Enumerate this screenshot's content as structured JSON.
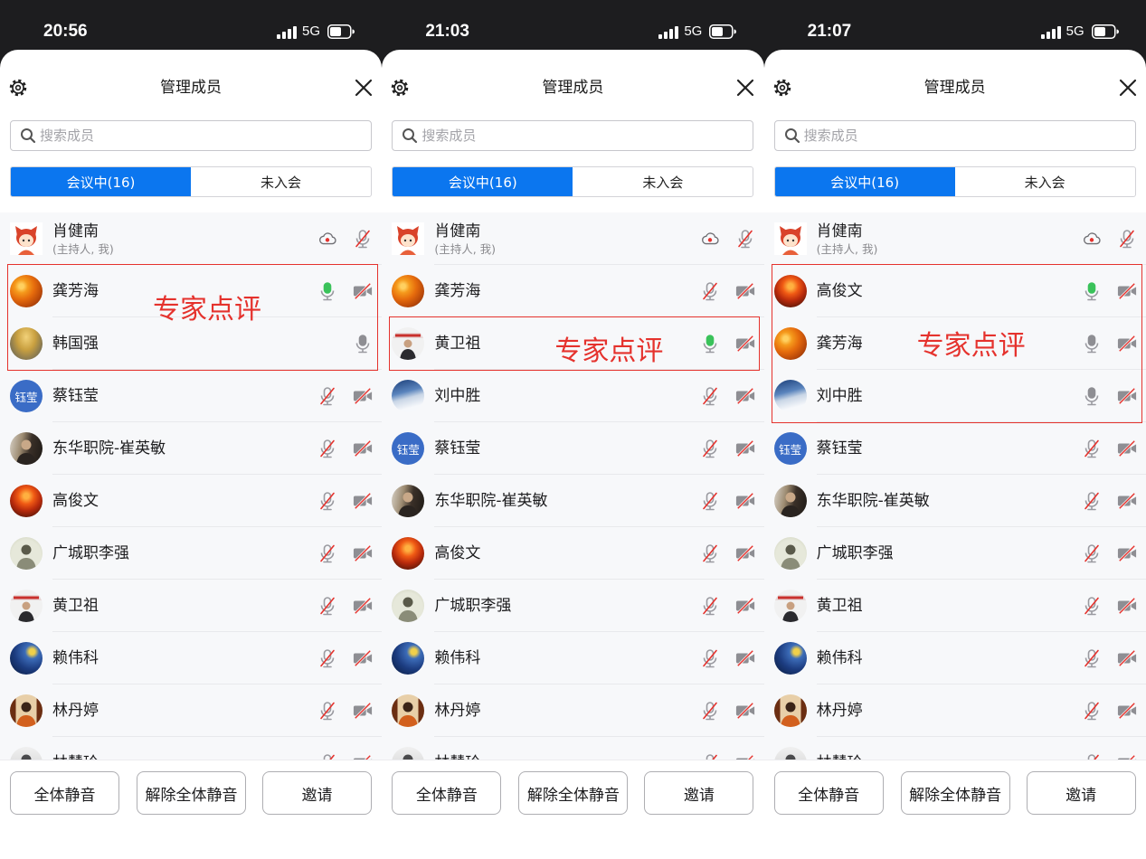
{
  "theme": {
    "accent": "#0b76ef",
    "annotation": "#e5322d",
    "mic_active": "#3ac25a",
    "status_bar": "#1d1d1f"
  },
  "panels": [
    {
      "status_bar": {
        "time": "20:56",
        "network": "5G",
        "signal_icon": "signal-icon",
        "battery_icon": "battery-icon"
      },
      "header": {
        "settings_icon": "gear-icon",
        "title": "管理成员",
        "close_icon": "close-icon"
      },
      "search": {
        "icon": "search-icon",
        "placeholder": "搜索成员"
      },
      "tabs": [
        {
          "label": "会议中(16)",
          "active": true
        },
        {
          "label": "未入会",
          "active": false
        }
      ],
      "members": [
        {
          "name": "肖健南",
          "role": "(主持人, 我)",
          "avatar": "cartoon-avatar",
          "icons": [
            "cloud-record-icon",
            "mic-muted-icon"
          ]
        },
        {
          "name": "龚芳海",
          "avatar": "orange-flowers-avatar",
          "icons": [
            "mic-active-icon",
            "video-off-icon"
          ],
          "highlighted": true
        },
        {
          "name": "韩国强",
          "avatar": "autumn-tree-avatar",
          "icons": [
            "mic-on-icon"
          ],
          "highlighted": true
        },
        {
          "name": "蔡钰莹",
          "avatar": "text-avatar",
          "avatar_text": "钰莹",
          "icons": [
            "mic-muted-icon",
            "video-off-icon"
          ]
        },
        {
          "name": "东华职院-崔英敏",
          "avatar": "dark-photo-avatar",
          "icons": [
            "mic-muted-icon",
            "video-off-icon"
          ]
        },
        {
          "name": "高俊文",
          "avatar": "red-lanterns-avatar",
          "icons": [
            "mic-muted-icon",
            "video-off-icon"
          ]
        },
        {
          "name": "广城职李强",
          "avatar": "sketch-avatar",
          "icons": [
            "mic-muted-icon",
            "video-off-icon"
          ]
        },
        {
          "name": "黄卫祖",
          "avatar": "speaker-avatar",
          "icons": [
            "mic-muted-icon",
            "video-off-icon"
          ]
        },
        {
          "name": "赖伟科",
          "avatar": "starry-night-avatar",
          "icons": [
            "mic-muted-icon",
            "video-off-icon"
          ]
        },
        {
          "name": "林丹婷",
          "avatar": "portrait-avatar",
          "icons": [
            "mic-muted-icon",
            "video-off-icon"
          ]
        },
        {
          "name": "林慧玲",
          "avatar": "silhouette-avatar",
          "icons": [
            "mic-muted-icon",
            "video-off-icon"
          ]
        }
      ],
      "annotation": {
        "label": "专家点评"
      },
      "footer": {
        "buttons": [
          "全体静音",
          "解除全体静音",
          "邀请"
        ]
      }
    },
    {
      "status_bar": {
        "time": "21:03",
        "network": "5G",
        "signal_icon": "signal-icon",
        "battery_icon": "battery-icon"
      },
      "header": {
        "settings_icon": "gear-icon",
        "title": "管理成员",
        "close_icon": "close-icon"
      },
      "search": {
        "icon": "search-icon",
        "placeholder": "搜索成员"
      },
      "tabs": [
        {
          "label": "会议中(16)",
          "active": true
        },
        {
          "label": "未入会",
          "active": false
        }
      ],
      "members": [
        {
          "name": "肖健南",
          "role": "(主持人, 我)",
          "avatar": "cartoon-avatar",
          "icons": [
            "cloud-record-icon",
            "mic-muted-icon"
          ]
        },
        {
          "name": "龚芳海",
          "avatar": "orange-flowers-avatar",
          "icons": [
            "mic-muted-icon",
            "video-off-icon"
          ]
        },
        {
          "name": "黄卫祖",
          "avatar": "speaker-avatar",
          "icons": [
            "mic-active-icon",
            "video-off-icon"
          ],
          "highlighted": true
        },
        {
          "name": "刘中胜",
          "avatar": "snow-mountain-avatar",
          "icons": [
            "mic-muted-icon",
            "video-off-icon"
          ]
        },
        {
          "name": "蔡钰莹",
          "avatar": "text-avatar",
          "avatar_text": "钰莹",
          "icons": [
            "mic-muted-icon",
            "video-off-icon"
          ]
        },
        {
          "name": "东华职院-崔英敏",
          "avatar": "dark-photo-avatar",
          "icons": [
            "mic-muted-icon",
            "video-off-icon"
          ]
        },
        {
          "name": "高俊文",
          "avatar": "red-lanterns-avatar",
          "icons": [
            "mic-muted-icon",
            "video-off-icon"
          ]
        },
        {
          "name": "广城职李强",
          "avatar": "sketch-avatar",
          "icons": [
            "mic-muted-icon",
            "video-off-icon"
          ]
        },
        {
          "name": "赖伟科",
          "avatar": "starry-night-avatar",
          "icons": [
            "mic-muted-icon",
            "video-off-icon"
          ]
        },
        {
          "name": "林丹婷",
          "avatar": "portrait-avatar",
          "icons": [
            "mic-muted-icon",
            "video-off-icon"
          ]
        },
        {
          "name": "林慧玲",
          "avatar": "silhouette-avatar",
          "icons": [
            "mic-muted-icon",
            "video-off-icon"
          ]
        }
      ],
      "annotation": {
        "label": "专家点评"
      },
      "footer": {
        "buttons": [
          "全体静音",
          "解除全体静音",
          "邀请"
        ]
      }
    },
    {
      "status_bar": {
        "time": "21:07",
        "network": "5G",
        "signal_icon": "signal-icon",
        "battery_icon": "battery-icon"
      },
      "header": {
        "settings_icon": "gear-icon",
        "title": "管理成员",
        "close_icon": "close-icon"
      },
      "search": {
        "icon": "search-icon",
        "placeholder": "搜索成员"
      },
      "tabs": [
        {
          "label": "会议中(16)",
          "active": true
        },
        {
          "label": "未入会",
          "active": false
        }
      ],
      "members": [
        {
          "name": "肖健南",
          "role": "(主持人, 我)",
          "avatar": "cartoon-avatar",
          "icons": [
            "cloud-record-icon",
            "mic-muted-icon"
          ]
        },
        {
          "name": "高俊文",
          "avatar": "red-lanterns-avatar",
          "icons": [
            "mic-active-icon",
            "video-off-icon"
          ],
          "highlighted": true
        },
        {
          "name": "龚芳海",
          "avatar": "orange-flowers-avatar",
          "icons": [
            "mic-on-icon",
            "video-off-icon"
          ],
          "highlighted": true
        },
        {
          "name": "刘中胜",
          "avatar": "snow-mountain-avatar",
          "icons": [
            "mic-on-icon",
            "video-off-icon"
          ],
          "highlighted": true
        },
        {
          "name": "蔡钰莹",
          "avatar": "text-avatar",
          "avatar_text": "钰莹",
          "icons": [
            "mic-muted-icon",
            "video-off-icon"
          ]
        },
        {
          "name": "东华职院-崔英敏",
          "avatar": "dark-photo-avatar",
          "icons": [
            "mic-muted-icon",
            "video-off-icon"
          ]
        },
        {
          "name": "广城职李强",
          "avatar": "sketch-avatar",
          "icons": [
            "mic-muted-icon",
            "video-off-icon"
          ]
        },
        {
          "name": "黄卫祖",
          "avatar": "speaker-avatar",
          "icons": [
            "mic-muted-icon",
            "video-off-icon"
          ]
        },
        {
          "name": "赖伟科",
          "avatar": "starry-night-avatar",
          "icons": [
            "mic-muted-icon",
            "video-off-icon"
          ]
        },
        {
          "name": "林丹婷",
          "avatar": "portrait-avatar",
          "icons": [
            "mic-muted-icon",
            "video-off-icon"
          ]
        },
        {
          "name": "林慧玲",
          "avatar": "silhouette-avatar",
          "icons": [
            "mic-muted-icon",
            "video-off-icon"
          ]
        }
      ],
      "annotation": {
        "label": "专家点评"
      },
      "footer": {
        "buttons": [
          "全体静音",
          "解除全体静音",
          "邀请"
        ]
      }
    }
  ]
}
